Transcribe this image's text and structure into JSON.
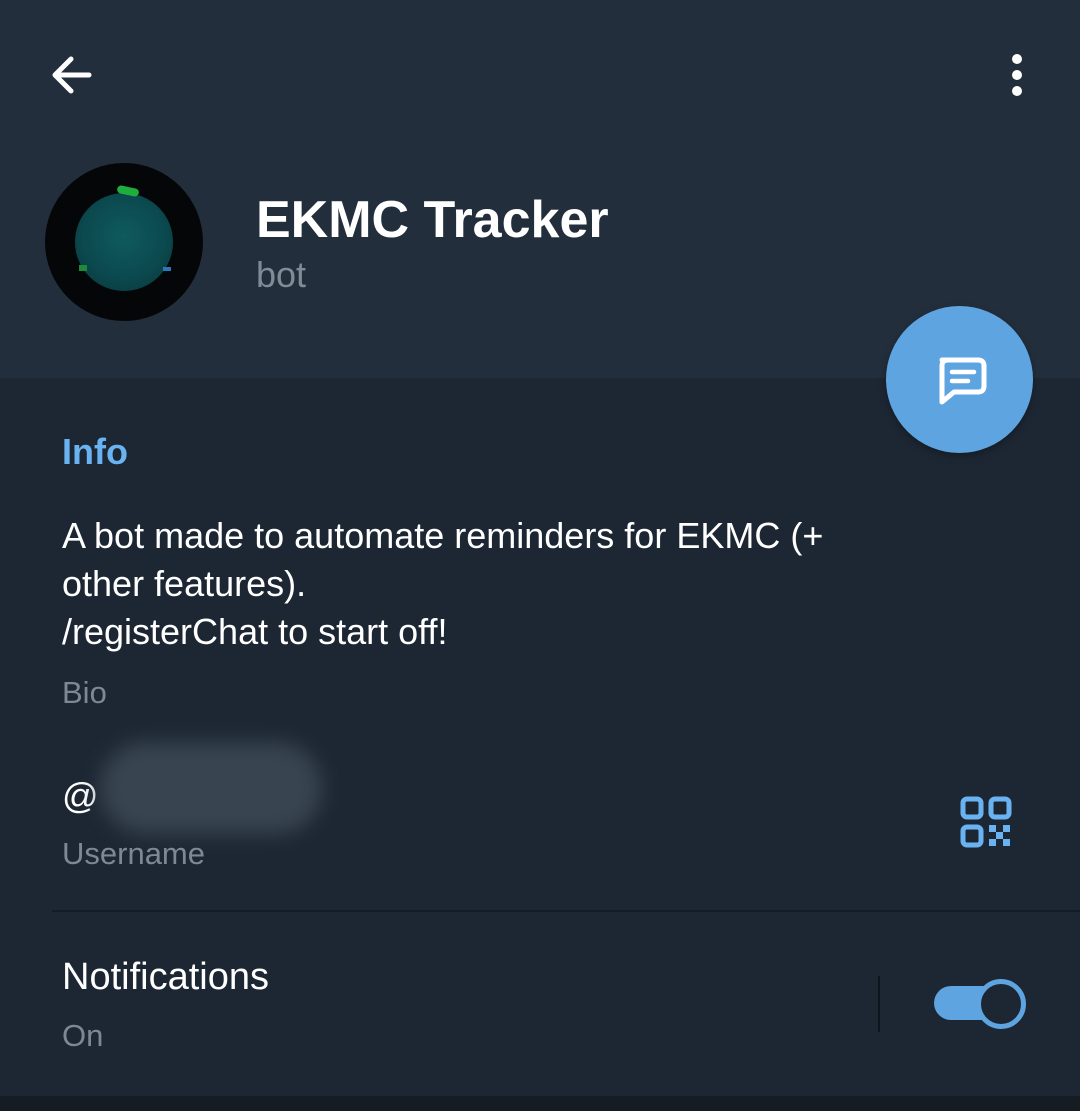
{
  "header": {
    "name": "EKMC Tracker",
    "subtitle": "bot"
  },
  "info": {
    "section_title": "Info",
    "bio_lines": [
      "A bot made to automate reminders for EKMC (+",
      "other features).",
      "/registerChat to start off!"
    ],
    "bio_label": "Bio",
    "username_prefix": "@",
    "username_label": "Username"
  },
  "notifications": {
    "title": "Notifications",
    "status": "On",
    "enabled": true
  },
  "icons": {
    "back": "arrow-left-icon",
    "menu": "more-vertical-icon",
    "message": "message-icon",
    "qr": "qr-code-icon"
  },
  "colors": {
    "accent": "#6ab3f3",
    "fab": "#5ea4e0",
    "background": "#1d2733",
    "header": "#232e3c"
  }
}
